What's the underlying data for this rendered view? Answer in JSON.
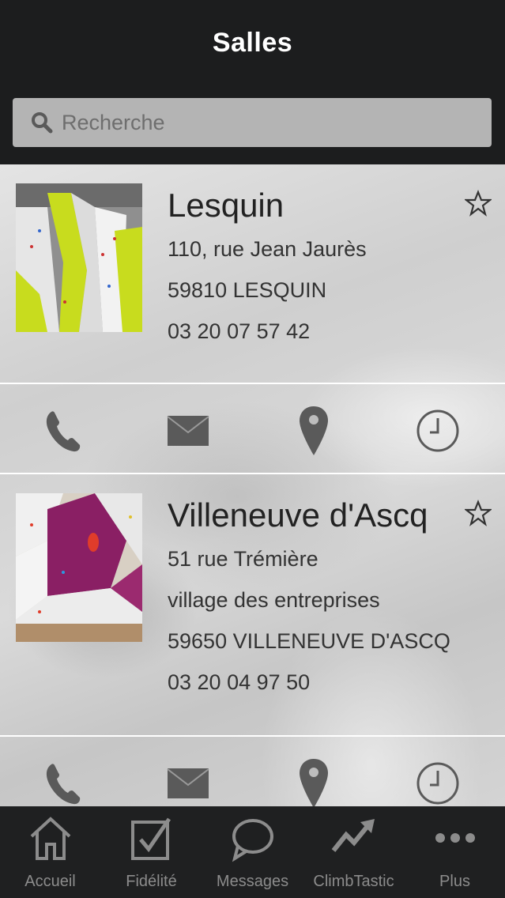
{
  "header": {
    "title": "Salles"
  },
  "search": {
    "placeholder": "Recherche"
  },
  "gyms": [
    {
      "name": "Lesquin",
      "lines": [
        "110, rue Jean Jaurès",
        "59810 LESQUIN",
        "03 20 07 57 42"
      ]
    },
    {
      "name": "Villeneuve d'Ascq",
      "lines": [
        "51 rue Trémière",
        "village des entreprises",
        "59650 VILLENEUVE D'ASCQ",
        "03 20 04 97 50"
      ]
    }
  ],
  "tabs": [
    {
      "label": "Accueil",
      "icon": "home-icon"
    },
    {
      "label": "Fidélité",
      "icon": "checkbox-icon"
    },
    {
      "label": "Messages",
      "icon": "speech-bubble-icon"
    },
    {
      "label": "ClimbTastic",
      "icon": "trend-arrow-icon"
    },
    {
      "label": "Plus",
      "icon": "more-dots-icon"
    }
  ],
  "colors": {
    "header_bg": "#1c1d1e",
    "tab_label": "#8c8c8c",
    "icon_gray": "#5a5a5a",
    "accent_yellow": "#c8dc1e",
    "accent_magenta": "#8a1f64"
  }
}
